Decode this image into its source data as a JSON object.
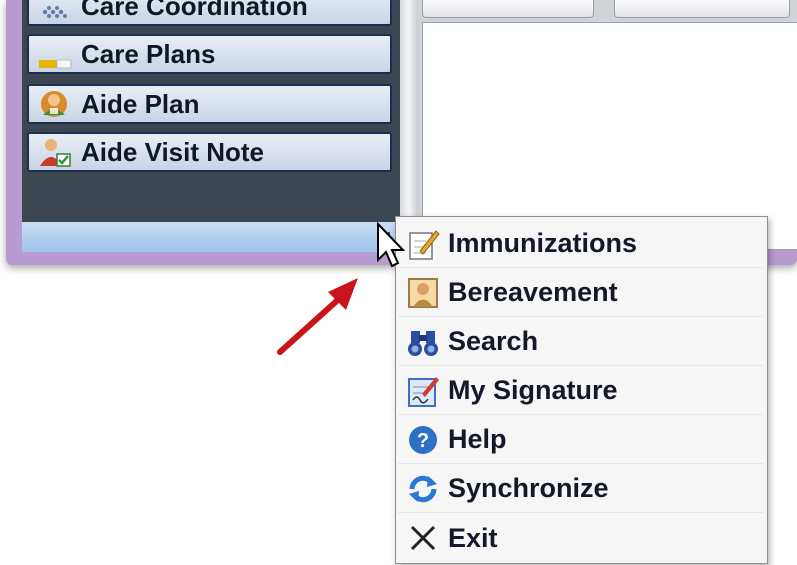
{
  "nav": {
    "items": [
      {
        "label": "Care Coordination",
        "icon": "snowflake-icon"
      },
      {
        "label": "Care Plans",
        "icon": "folder-icon"
      },
      {
        "label": "Aide Plan",
        "icon": "aide-person-icon"
      },
      {
        "label": "Aide Visit Note",
        "icon": "person-check-icon"
      }
    ]
  },
  "menu": {
    "items": [
      {
        "label": "Immunizations",
        "icon": "notepad-pencil-icon"
      },
      {
        "label": "Bereavement",
        "icon": "portrait-icon"
      },
      {
        "label": "Search",
        "icon": "binoculars-icon"
      },
      {
        "label": "My Signature",
        "icon": "signature-pad-icon"
      },
      {
        "label": "Help",
        "icon": "help-circle-icon"
      },
      {
        "label": "Synchronize",
        "icon": "sync-arrows-icon"
      },
      {
        "label": "Exit",
        "icon": "close-x-icon"
      }
    ]
  },
  "colors": {
    "window_frame": "#b89bd0",
    "nav_background": "#3c4650",
    "nav_button_border": "#1d2d55",
    "annotation_arrow": "#c8151b"
  }
}
